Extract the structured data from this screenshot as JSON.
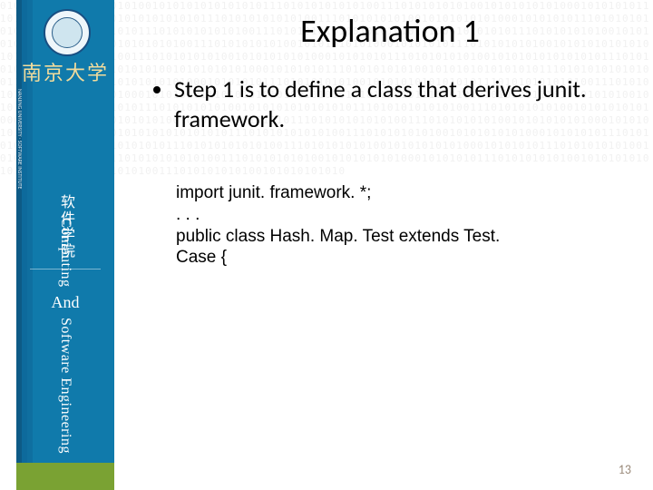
{
  "title": "Explanation 1",
  "bullet": "Step 1 is to define a class that derives junit. framework.",
  "code": {
    "l1": "import junit. framework. *;",
    "l2": ". . .",
    "l3": "public class Hash. Map. Test extends Test. Case {"
  },
  "sidebar": {
    "university_cn": "南京大学",
    "dept_cn": "软件学院",
    "university_en": "NANJING UNIVERSITY · SOFTWARE INSTITUTE",
    "topic_line1": "Computing",
    "topic_and": "And",
    "topic_line2": "Software Engineering"
  },
  "page_number": "13",
  "watermark_sample": "0101010111010101010100101010101010101011101010101"
}
